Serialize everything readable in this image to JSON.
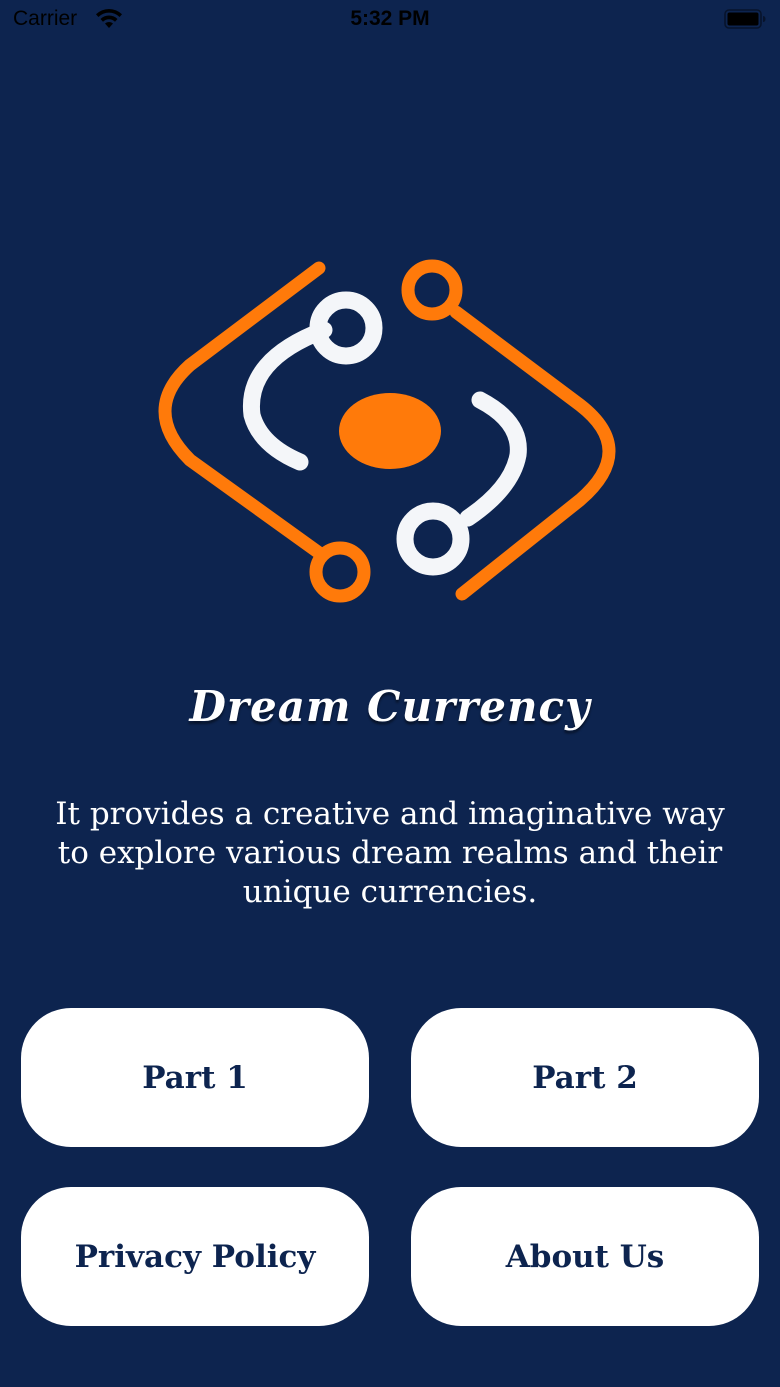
{
  "status_bar": {
    "carrier": "Carrier",
    "time": "5:32 PM"
  },
  "app": {
    "title": "Dream Currency",
    "description": "It provides a creative and imaginative way to explore various dream realms and their unique currencies."
  },
  "buttons": {
    "part1": "Part 1",
    "part2": "Part 2",
    "privacy": "Privacy Policy",
    "about": "About Us"
  },
  "colors": {
    "background": "#0d244f",
    "accent": "#ff7a0a",
    "logo_white": "#f4f6f9",
    "button_bg": "#ffffff",
    "button_text": "#0d244f"
  },
  "icons": {
    "wifi": "wifi-icon",
    "battery": "battery-icon",
    "logo": "dream-currency-logo-icon"
  }
}
